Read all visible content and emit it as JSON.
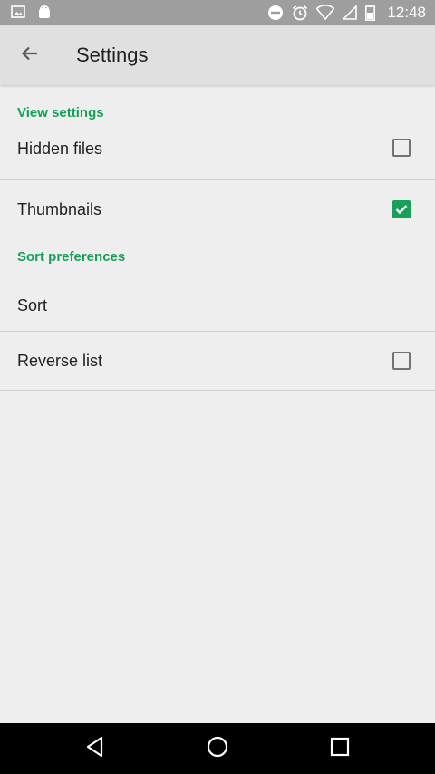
{
  "status_bar": {
    "time": "12:48",
    "left_icons": [
      "image-icon",
      "android-icon"
    ],
    "right_icons": [
      "do-not-disturb-icon",
      "alarm-icon",
      "wifi-icon",
      "signal-icon",
      "battery-icon"
    ]
  },
  "toolbar": {
    "title": "Settings",
    "back_icon": "arrow-back-icon"
  },
  "sections": [
    {
      "title": "View settings",
      "items": [
        {
          "label": "Hidden files",
          "checkbox": true,
          "checked": false
        },
        {
          "label": "Thumbnails",
          "checkbox": true,
          "checked": true
        }
      ]
    },
    {
      "title": "Sort preferences",
      "items": [
        {
          "label": "Sort",
          "checkbox": false
        },
        {
          "label": "Reverse list",
          "checkbox": true,
          "checked": false
        }
      ]
    }
  ],
  "colors": {
    "accent": "#16a05a",
    "background": "#eeeeee",
    "app_bar": "#e0e0e0",
    "status_bar": "#9e9e9e"
  },
  "nav_bar": {
    "icons": [
      "back-triangle-icon",
      "home-circle-icon",
      "recents-square-icon"
    ]
  }
}
